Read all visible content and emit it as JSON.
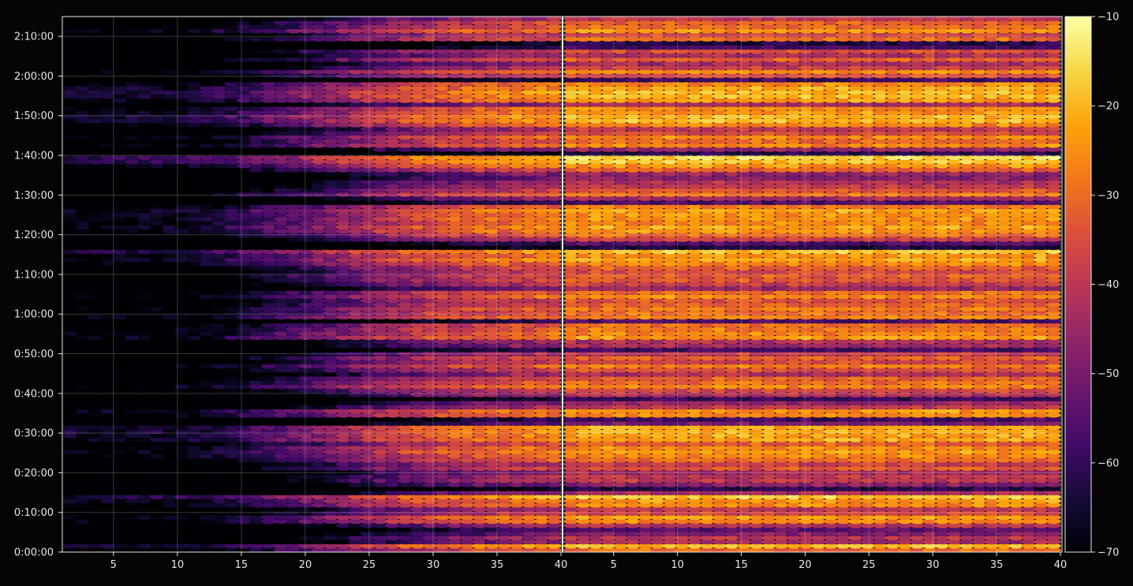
{
  "chart_data": {
    "type": "heatmap",
    "title": "",
    "xlabel": "",
    "ylabel": "",
    "background": "#050505",
    "colormap": "inferno",
    "panels": [
      {
        "name": "",
        "x_range": [
          1,
          40
        ],
        "x_ticks": [
          5,
          10,
          15,
          20,
          25,
          30,
          35,
          40
        ]
      },
      {
        "name": "",
        "x_range": [
          1,
          40
        ],
        "x_ticks": [
          5,
          10,
          15,
          20,
          25,
          30,
          35,
          40
        ]
      }
    ],
    "y_range_seconds": [
      0,
      8100
    ],
    "y_ticks": [
      "0:00:00",
      "0:10:00",
      "0:20:00",
      "0:30:00",
      "0:40:00",
      "0:50:00",
      "1:00:00",
      "1:10:00",
      "1:20:00",
      "1:30:00",
      "1:40:00",
      "1:50:00",
      "2:00:00",
      "2:10:00"
    ],
    "colorbar": {
      "range": [
        -70,
        -10
      ],
      "ticks": [
        "−10",
        "−20",
        "−30",
        "−40",
        "−50",
        "−60",
        "−70"
      ]
    },
    "grid": true,
    "row_profile_db": [
      -34,
      -24,
      -48,
      -45,
      -52,
      -58,
      -46,
      -30,
      -28,
      -40,
      -44,
      -30,
      -28,
      -22,
      -48,
      -66,
      -52,
      -44,
      -44,
      -48,
      -38,
      -42,
      -34,
      -30,
      -28,
      -30,
      -36,
      -26,
      -26,
      -25,
      -26,
      -55,
      -62,
      -30,
      -28,
      -44,
      -50,
      -64,
      -46,
      -40,
      -30,
      -34,
      -36,
      -46,
      -38,
      -32,
      -40,
      -36,
      -44,
      -62,
      -48,
      -46,
      -28,
      -30,
      -32,
      -34,
      -60,
      -30,
      -34,
      -32,
      -36,
      -38,
      -30,
      -34,
      -50,
      -42,
      -38,
      -36,
      -40,
      -36,
      -30,
      -26,
      -28,
      -22,
      -68,
      -60,
      -42,
      -34,
      -28,
      -26,
      -30,
      -28,
      -28,
      -26,
      -32,
      -60,
      -48,
      -32,
      -38,
      -44,
      -46,
      -52,
      -50,
      -36,
      -28,
      -22,
      -20,
      -66,
      -50,
      -30,
      -34,
      -30,
      -40,
      -44,
      -30,
      -24,
      -24,
      -28,
      -30,
      -48,
      -28,
      -24,
      -24,
      -26,
      -30,
      -62,
      -40,
      -30,
      -42,
      -48,
      -36,
      -46,
      -40,
      -62,
      -66,
      -34,
      -40,
      -28,
      -34,
      -36,
      -44
    ],
    "left_panel_ramp": [
      [
        0.8,
        -70
      ],
      [
        3.0,
        -70
      ],
      [
        6.0,
        -70
      ],
      [
        9.0,
        -69
      ],
      [
        13.0,
        -66
      ],
      [
        17.0,
        -59
      ],
      [
        21.0,
        -52
      ],
      [
        26.0,
        -42
      ],
      [
        31.0,
        -35
      ],
      [
        36.0,
        -31
      ],
      [
        40.0,
        -29
      ]
    ],
    "right_panel_offset_db": 4
  }
}
